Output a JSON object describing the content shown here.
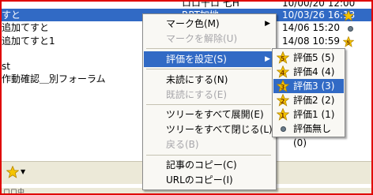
{
  "list": {
    "rows": [
      {
        "title": "",
        "from": "ロロ千ロ 七H",
        "date": "10/00/20 12:00",
        "rating": ""
      },
      {
        "title": "すと",
        "from": "RPT加地",
        "date": "10/03/26 16:13",
        "rating": "none"
      },
      {
        "title": "追加てすと",
        "from": "",
        "date": "14/06 15:20",
        "rating": "dot"
      },
      {
        "title": "追加てすと1",
        "from": "",
        "date": "14/08 10:59",
        "rating": "5"
      },
      {
        "title": "",
        "from": "",
        "date": "",
        "rating": ""
      },
      {
        "title": "st",
        "from": "",
        "date": "",
        "rating": ""
      },
      {
        "title": "作動確認＿別フォーラム",
        "from": "",
        "date": "",
        "rating": ""
      }
    ]
  },
  "context_menu": {
    "items": [
      {
        "label": "マーク色(M)",
        "enabled": true,
        "submenu": true
      },
      {
        "label": "マークを解除(U)",
        "enabled": false
      },
      {
        "label": "評価を設定(S)",
        "enabled": true,
        "submenu": true,
        "highlighted": true
      },
      {
        "label": "未読にする(N)",
        "enabled": true
      },
      {
        "label": "既読にする(E)",
        "enabled": false
      },
      {
        "label": "ツリーをすべて展開(E)",
        "enabled": true
      },
      {
        "label": "ツリーをすべて閉じる(L)",
        "enabled": true
      },
      {
        "label": "戻る(B)",
        "enabled": false
      },
      {
        "label": "記事のコピー(C)",
        "enabled": true
      },
      {
        "label": "URLのコピー(I)",
        "enabled": true
      }
    ]
  },
  "rating_submenu": {
    "items": [
      {
        "label": "評価5 (5)",
        "icon": "star-5-icon"
      },
      {
        "label": "評価4 (4)",
        "icon": "star-4-icon"
      },
      {
        "label": "評価3 (3)",
        "icon": "star-3-icon",
        "highlighted": true
      },
      {
        "label": "評価2 (2)",
        "icon": "star-2-icon"
      },
      {
        "label": "評価1 (1)",
        "icon": "star-1-icon"
      },
      {
        "label": "評価無し(0)",
        "icon": "none-dot-icon"
      }
    ]
  },
  "status": {
    "text": "ロロ中"
  },
  "colors": {
    "highlight": "#316ac5",
    "frame": "#e00000",
    "star": "#f5c400"
  }
}
